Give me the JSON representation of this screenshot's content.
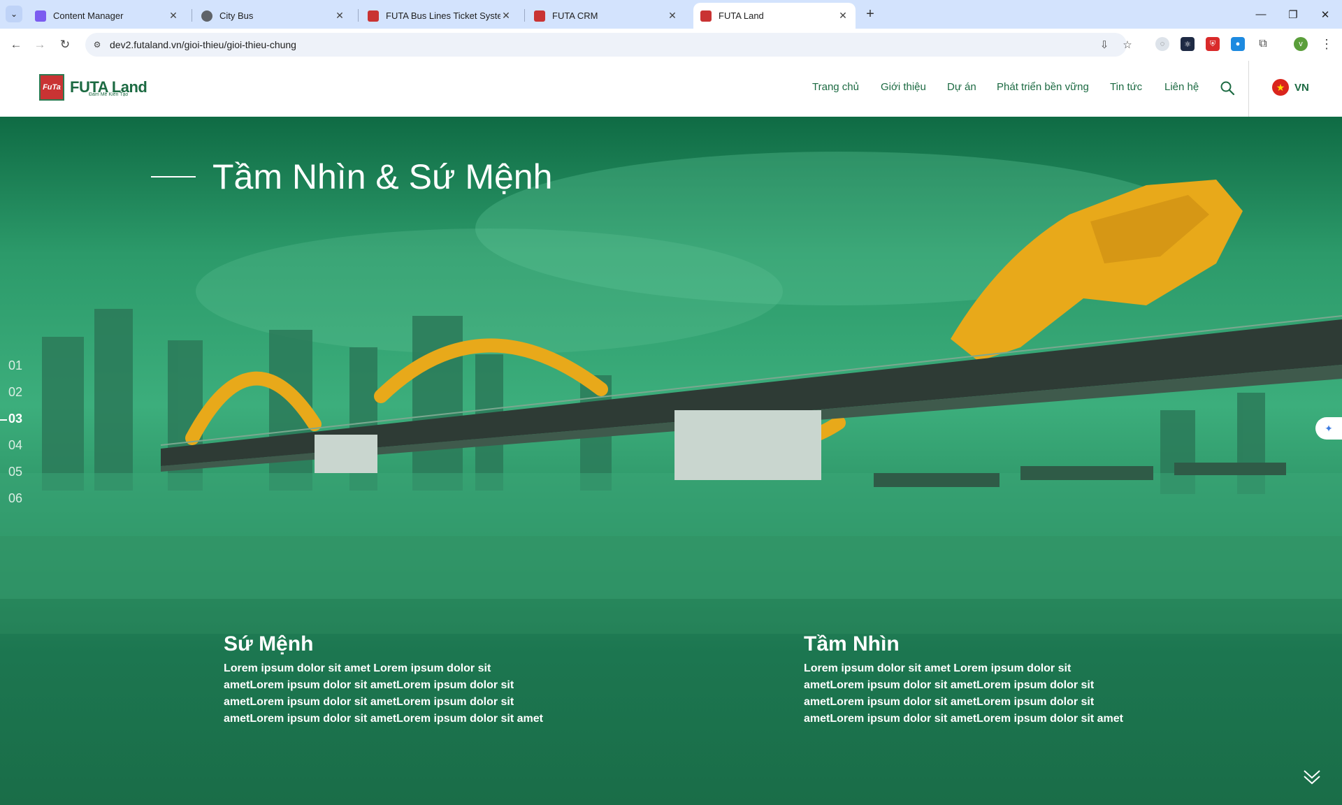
{
  "browser": {
    "tabs": [
      {
        "title": "Content Manager",
        "favicon_color": "#7b5cf0"
      },
      {
        "title": "City Bus",
        "favicon_color": "#5f6368"
      },
      {
        "title": "FUTA Bus Lines Ticket System",
        "favicon_color": "#c93333"
      },
      {
        "title": "FUTA CRM",
        "favicon_color": "#c93333"
      },
      {
        "title": "FUTA Land",
        "favicon_color": "#c93333",
        "active": true
      }
    ],
    "url": "dev2.futaland.vn/gioi-thieu/gioi-thieu-chung",
    "profile_initial": "v"
  },
  "site": {
    "logo_text": "FUTA Land",
    "logo_mark": "FuTa",
    "logo_tagline": "Đam Mê Kiến Tạo",
    "nav": [
      "Trang chủ",
      "Giới thiệu",
      "Dự án",
      "Phát triển bền vững",
      "Tin tức",
      "Liên hệ"
    ],
    "lang": "VN"
  },
  "hero": {
    "heading": "Tầm Nhìn & Sứ Mệnh",
    "slide_indices": [
      "01",
      "02",
      "03",
      "04",
      "05",
      "06"
    ],
    "active_index": "03",
    "mission": {
      "title": "Sứ Mệnh",
      "body": "Lorem ipsum dolor sit amet Lorem ipsum dolor sit ametLorem ipsum dolor sit ametLorem ipsum dolor sit ametLorem ipsum dolor sit ametLorem ipsum dolor sit ametLorem ipsum dolor sit ametLorem ipsum dolor sit amet"
    },
    "vision": {
      "title": "Tầm Nhìn",
      "body": "Lorem ipsum dolor sit amet Lorem ipsum dolor sit ametLorem ipsum dolor sit ametLorem ipsum dolor sit ametLorem ipsum dolor sit ametLorem ipsum dolor sit ametLorem ipsum dolor sit ametLorem ipsum dolor sit amet"
    }
  },
  "colors": {
    "brand_green": "#1c6a42",
    "hero_green": "#1a6d48",
    "dragon_gold": "#e8a91a"
  }
}
